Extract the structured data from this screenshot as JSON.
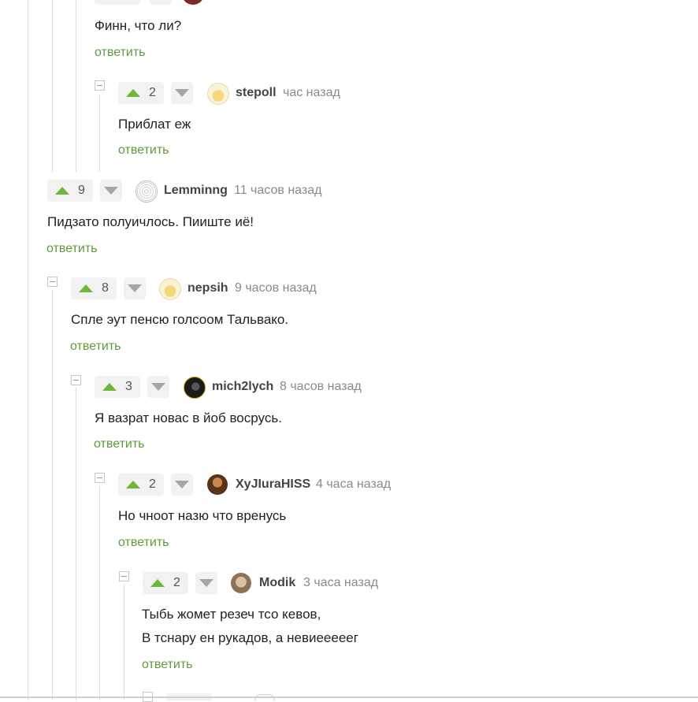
{
  "reply_label": "ответить",
  "colors": {
    "accent_green": "#6fb63a",
    "link_green": "#5c9d3a",
    "muted": "#8a8a8a"
  },
  "comments": [
    {
      "id": "c0",
      "text": "Финн, что ли?"
    },
    {
      "id": "c1",
      "rating": "2",
      "user": "stepoll",
      "time": "час назад",
      "text": "Приблат еж",
      "avatar": "pale-yellow-avatar"
    },
    {
      "id": "c2",
      "rating": "9",
      "user": "Lemminng",
      "time": "11 часов назад",
      "text": "Пидзато полуичлось. Пииште иё!",
      "avatar": "sketch-avatar"
    },
    {
      "id": "c3",
      "rating": "8",
      "user": "nepsih",
      "time": "9 часов назад",
      "text": "Спле эут пенсю голсоом Тальвако.",
      "avatar": "pale-yellow-avatar"
    },
    {
      "id": "c4",
      "rating": "3",
      "user": "mich2lych",
      "time": "8 часов назад",
      "text": "Я вазрат новас в йоб восрусь.",
      "avatar": "dark-avatar"
    },
    {
      "id": "c5",
      "rating": "2",
      "user": "XyJIuraHISS",
      "time": "4 часа назад",
      "text": "Но чноот назю что вренусь",
      "avatar": "brown-avatar"
    },
    {
      "id": "c6",
      "rating": "2",
      "user": "Modik",
      "time": "3 часа назад",
      "text_lines": [
        "Тыбь жомет резеч тсо кевов,",
        "В тснару ен рукадов, а невиееееег"
      ],
      "avatar": "beige-avatar"
    }
  ]
}
